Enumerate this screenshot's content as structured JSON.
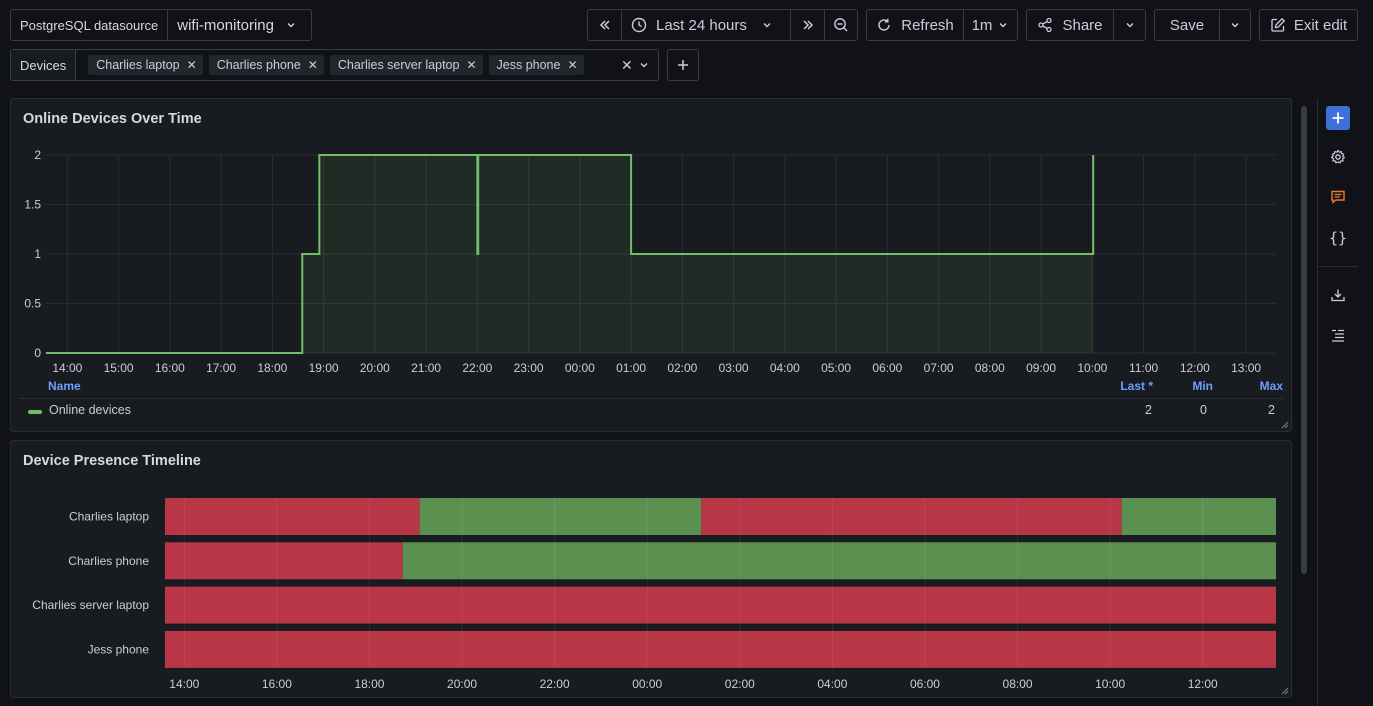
{
  "toolbar": {
    "datasource_label": "PostgreSQL datasource",
    "datasource_value": "wifi-monitoring",
    "time_range": "Last 24 hours",
    "refresh_label": "Refresh",
    "refresh_interval": "1m",
    "share_label": "Share",
    "save_label": "Save",
    "exit_label": "Exit edit"
  },
  "filter": {
    "label": "Devices",
    "chips": [
      "Charlies laptop",
      "Charlies phone",
      "Charlies server laptop",
      "Jess phone"
    ]
  },
  "colors": {
    "accent": "#3d71d9",
    "green": "#73bf69",
    "red": "#b83646",
    "present_green": "#5a9150"
  },
  "icons": [
    "rewind-icon",
    "clock-icon",
    "chevron-down-icon",
    "fast-forward-icon",
    "zoom-out-icon",
    "refresh-icon",
    "share-icon",
    "edit-icon",
    "close-icon",
    "plus-icon",
    "gear-icon",
    "comment-icon",
    "braces-icon",
    "download-icon",
    "list-icon"
  ],
  "panel1": {
    "title": "Online Devices Over Time",
    "legend": {
      "headers": {
        "name": "Name",
        "last": "Last *",
        "min": "Min",
        "max": "Max"
      },
      "rows": [
        {
          "name": "Online devices",
          "last": "2",
          "min": "0",
          "max": "2"
        }
      ]
    }
  },
  "panel2": {
    "title": "Device Presence Timeline"
  },
  "chart_data": [
    {
      "type": "line",
      "title": "Online Devices Over Time",
      "x_range": [
        "13:35",
        "13:35 (+1d)"
      ],
      "x_ticks": [
        "14:00",
        "15:00",
        "16:00",
        "17:00",
        "18:00",
        "19:00",
        "20:00",
        "21:00",
        "22:00",
        "23:00",
        "00:00",
        "01:00",
        "02:00",
        "03:00",
        "04:00",
        "05:00",
        "06:00",
        "07:00",
        "08:00",
        "09:00",
        "10:00",
        "11:00",
        "12:00",
        "13:00"
      ],
      "y_ticks": [
        "0",
        "0.5",
        "1",
        "1.5",
        "2"
      ],
      "ylim": [
        0,
        2
      ],
      "grid": true,
      "legend_position": "bottom",
      "series": [
        {
          "name": "Online devices",
          "color": "#73bf69",
          "step": true,
          "fill": true,
          "points": [
            [
              "13:35",
              0
            ],
            [
              "18:35",
              1
            ],
            [
              "18:55",
              2
            ],
            [
              "22:00",
              1
            ],
            [
              "22:01",
              2
            ],
            [
              "01:00",
              1
            ],
            [
              "10:00",
              1
            ],
            [
              "10:01",
              2
            ]
          ]
        }
      ]
    },
    {
      "type": "timeline",
      "title": "Device Presence Timeline",
      "x_ticks": [
        "14:00",
        "16:00",
        "18:00",
        "20:00",
        "22:00",
        "00:00",
        "02:00",
        "04:00",
        "06:00",
        "08:00",
        "10:00",
        "12:00"
      ],
      "rows": [
        {
          "name": "Charlies laptop",
          "segments": [
            {
              "start": "13:35",
              "end": "19:05",
              "state": "offline",
              "color": "#b83646"
            },
            {
              "start": "19:05",
              "end": "01:10",
              "state": "online",
              "color": "#5a9150"
            },
            {
              "start": "01:10",
              "end": "10:15",
              "state": "offline",
              "color": "#b83646"
            },
            {
              "start": "10:15",
              "end": "13:35",
              "state": "online",
              "color": "#5a9150"
            }
          ]
        },
        {
          "name": "Charlies phone",
          "segments": [
            {
              "start": "13:35",
              "end": "18:43",
              "state": "offline",
              "color": "#b83646"
            },
            {
              "start": "18:43",
              "end": "13:35",
              "state": "online",
              "color": "#5a9150"
            }
          ]
        },
        {
          "name": "Charlies server laptop",
          "segments": [
            {
              "start": "13:35",
              "end": "13:35",
              "state": "offline",
              "color": "#b83646"
            }
          ]
        },
        {
          "name": "Jess phone",
          "segments": [
            {
              "start": "13:35",
              "end": "13:35",
              "state": "offline",
              "color": "#b83646"
            }
          ]
        }
      ]
    }
  ]
}
